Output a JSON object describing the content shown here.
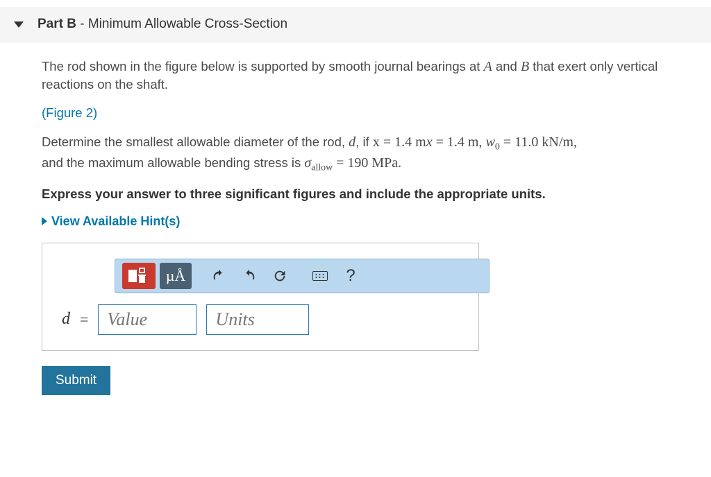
{
  "part": {
    "label": "Part B",
    "title": "Minimum Allowable Cross-Section"
  },
  "problem": {
    "intro": "The rod shown in the figure below is supported by smooth journal bearings at",
    "intro2": "that exert only vertical reactions on the shaft.",
    "A": "A",
    "B": "B",
    "and": "and",
    "figure_link": "(Figure 2)",
    "determine1": "Determine the smallest allowable diameter of the rod,",
    "var_d": "d",
    "comma_if": ", if",
    "x_eq": "x = 1.4 m",
    "comma": ",",
    "w0_lhs": "w",
    "w0_sub": "0",
    "w0_rhs": " = 11.0 kN/m",
    "determine2": "and the maximum allowable bending stress is",
    "sigma": "σ",
    "allow_sub": "allow",
    "sigma_rhs": " = 190 MPa.",
    "express": "Express your answer to three significant figures and include the appropriate units."
  },
  "hints_label": "View Available Hint(s)",
  "toolbar": {
    "units_label": "µÅ",
    "help": "?"
  },
  "answer": {
    "var": "d",
    "eq": "=",
    "value_placeholder": "Value",
    "units_placeholder": "Units"
  },
  "submit_label": "Submit"
}
